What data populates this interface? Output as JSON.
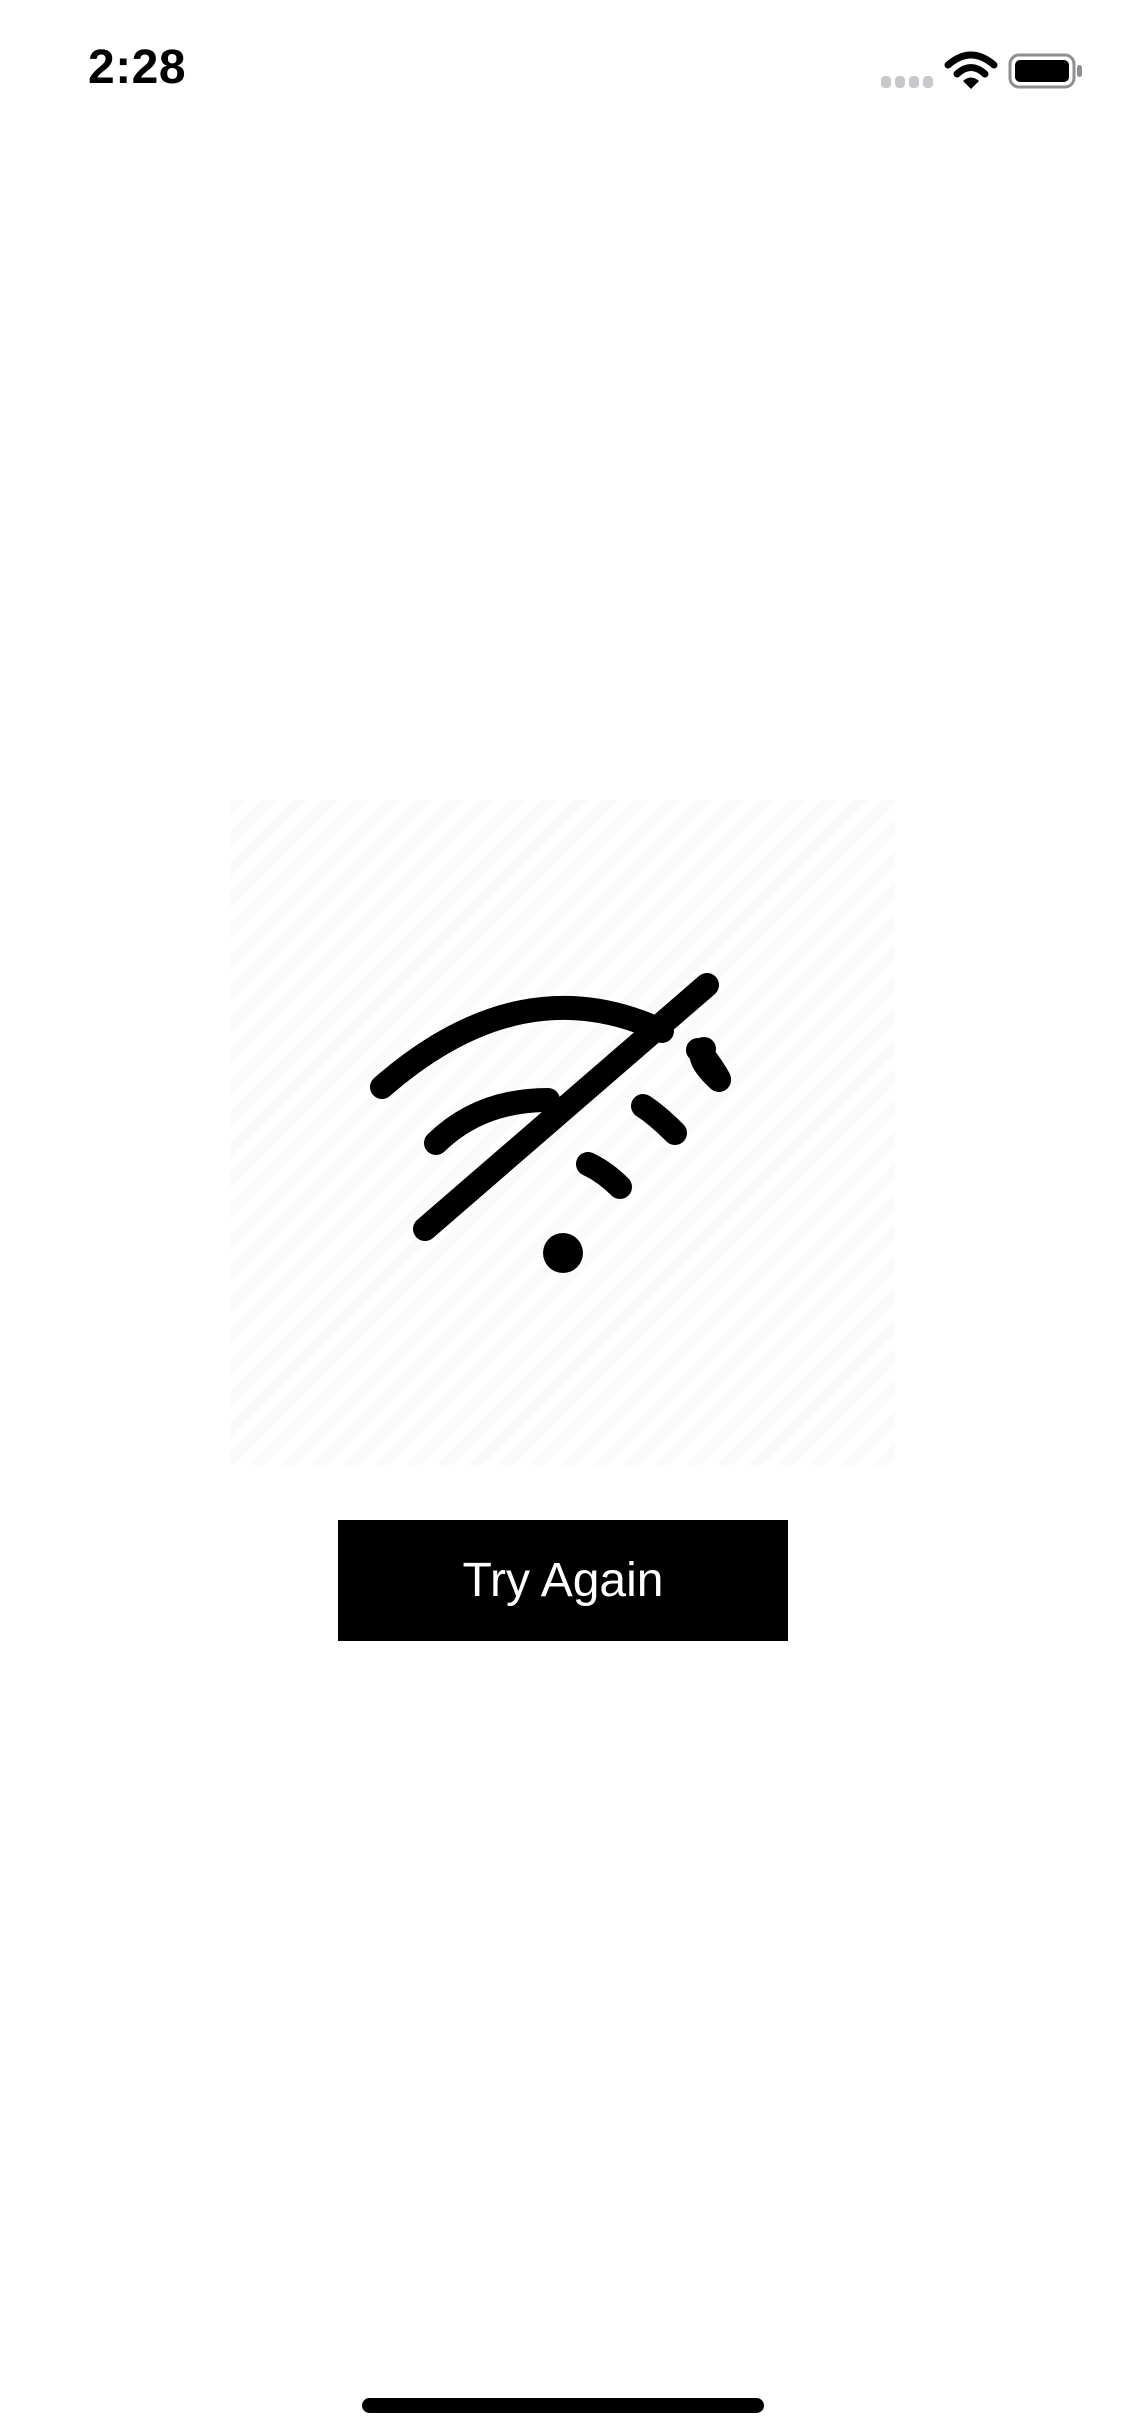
{
  "status_bar": {
    "time": "2:28",
    "icons": [
      "cellular-signal-icon",
      "wifi-icon",
      "battery-icon"
    ]
  },
  "main": {
    "illustration_icon": "wifi-off-icon",
    "retry_button_label": "Try Again"
  },
  "colors": {
    "background": "#ffffff",
    "button_background": "#000000",
    "button_text": "#ffffff",
    "icon": "#000000"
  }
}
